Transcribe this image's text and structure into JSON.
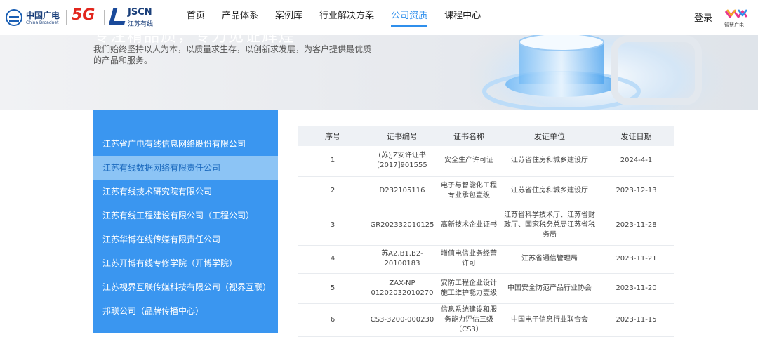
{
  "header": {
    "logo_cn": "中国广电",
    "logo_en": "China Broadnet",
    "logo_5g": "5G",
    "logo_jscn": "JSCN",
    "logo_jscn_sub": "江苏有线",
    "nav": [
      {
        "label": "首页",
        "active": false
      },
      {
        "label": "产品体系",
        "active": false
      },
      {
        "label": "案例库",
        "active": false
      },
      {
        "label": "行业解决方案",
        "active": false
      },
      {
        "label": "公司资质",
        "active": true
      },
      {
        "label": "课程中心",
        "active": false
      }
    ],
    "login": "登录",
    "brand_label": "智慧广电"
  },
  "banner": {
    "title": "专注精品质，专力见证辉煌",
    "desc": "我们始终坚持以人为本，以质量求生存，以创新求发展，为客户提供最优质的产品和服务。"
  },
  "sidebar": {
    "items": [
      {
        "label": "江苏省广电有线信息网络股份有限公司",
        "active": false
      },
      {
        "label": "江苏有线数据网络有限责任公司",
        "active": true
      },
      {
        "label": "江苏有线技术研究院有限公司",
        "active": false
      },
      {
        "label": "江苏有线工程建设有限公司（工程公司）",
        "active": false
      },
      {
        "label": "江苏华博在线传媒有限责任公司",
        "active": false
      },
      {
        "label": "江苏开博有线专修学院（开博学院）",
        "active": false
      },
      {
        "label": "江苏视界互联传媒科技有限公司（视界互联）",
        "active": false
      },
      {
        "label": "邦联公司（品牌传播中心）",
        "active": false
      }
    ]
  },
  "table": {
    "headers": [
      "序号",
      "证书编号",
      "证书名称",
      "发证单位",
      "发证日期"
    ],
    "rows": [
      {
        "no": "1",
        "cert_no": "(苏)JZ安许证书[2017]901555",
        "name": "安全生产许可证",
        "issuer": "江苏省住房和城乡建设厅",
        "date": "2024-4-1"
      },
      {
        "no": "2",
        "cert_no": "D232105116",
        "name": "电子与智能化工程专业承包壹级",
        "issuer": "江苏省住房和城乡建设厅",
        "date": "2023-12-13"
      },
      {
        "no": "3",
        "cert_no": "GR202332010125",
        "name": "高新技术企业证书",
        "issuer": "江苏省科学技术厅、江苏省财政厅、国家税务总局江苏省税务局",
        "date": "2023-11-28"
      },
      {
        "no": "4",
        "cert_no": "苏A2.B1.B2-20100183",
        "name": "增值电信业务经营许可",
        "issuer": "江苏省通信管理局",
        "date": "2023-11-21"
      },
      {
        "no": "5",
        "cert_no": "ZAX-NP 01202032010270",
        "name": "安防工程企业设计施工维护能力壹级",
        "issuer": "中国安全防范产品行业协会",
        "date": "2023-11-20"
      },
      {
        "no": "6",
        "cert_no": "CS3-3200-000230",
        "name": "信息系统建设和服务能力评估三级（CS3）",
        "issuer": "中国电子信息行业联合会",
        "date": "2023-11-15"
      }
    ]
  }
}
